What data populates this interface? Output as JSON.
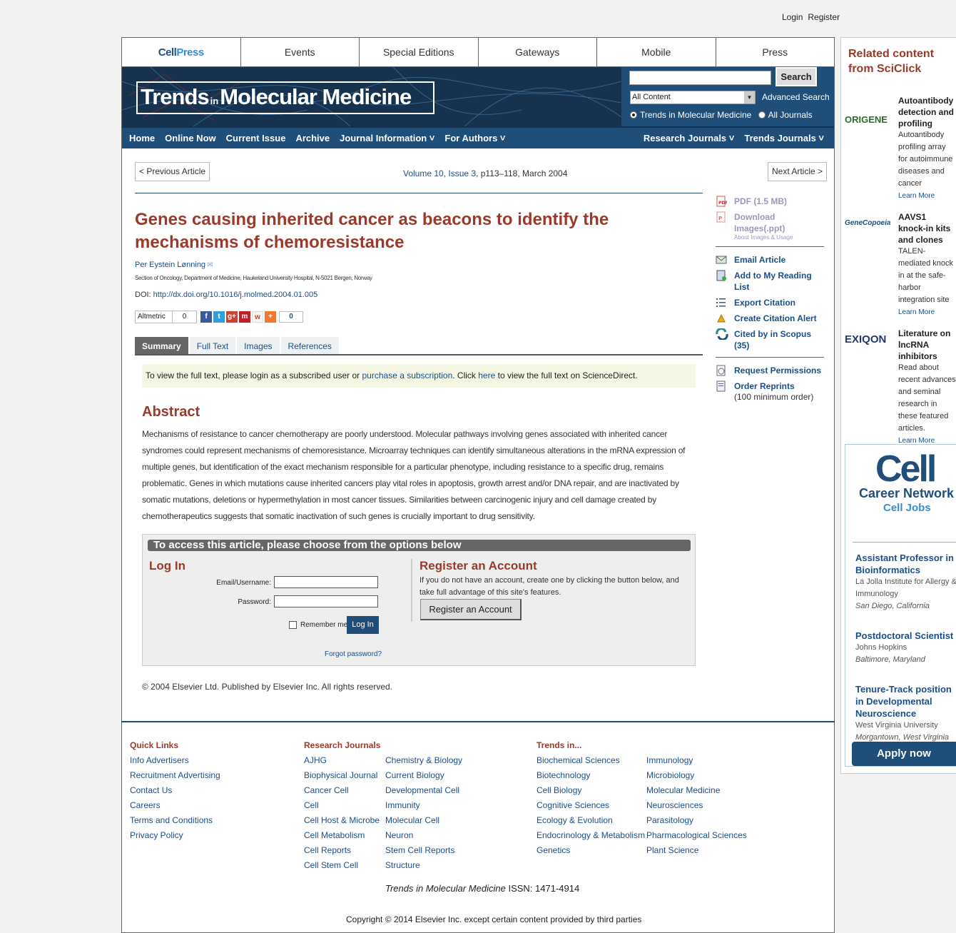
{
  "top_links": {
    "login": "Login",
    "register": "Register"
  },
  "topnav": {
    "cellpress_1": "Cell",
    "cellpress_2": "Press",
    "items": [
      "Events",
      "Special Editions",
      "Gateways",
      "Mobile",
      "Press"
    ]
  },
  "banner": {
    "logo_part1": "Trends",
    "logo_in": "in",
    "logo_part2": "Molecular Medicine",
    "search_button": "Search",
    "content_select": "All Content",
    "advanced_search": "Advanced Search",
    "radio_journal": "Trends in Molecular Medicine",
    "radio_all": "All Journals"
  },
  "mainnav": {
    "home": "Home",
    "online_now": "Online Now",
    "current_issue": "Current Issue",
    "archive": "Archive",
    "journal_info": "Journal Information ˅",
    "for_authors": "For Authors ˅",
    "research_journals": "Research Journals ˅",
    "trends_journals": "Trends Journals ˅"
  },
  "article_nav": {
    "prev": "< Previous Article",
    "next": "Next Article >",
    "volume": "Volume 10, Issue 3",
    "pages": ", p113–118, March 2004"
  },
  "article": {
    "title": "Genes causing inherited cancer as beacons to identify the mechanisms of chemoresistance",
    "author": "Per Eystein Lønning",
    "affiliation": "Section of Oncology, Department of Medicine, Haukeland University Hospital, N-5021 Bergen, Norway",
    "doi_label": "DOI: ",
    "doi_link": "http://dx.doi.org/10.1016/j.molmed.2004.01.005",
    "altmetric": "Altmetric",
    "altmetric_count": "0",
    "share_count": "0"
  },
  "tabs": [
    "Summary",
    "Full Text",
    "Images",
    "References"
  ],
  "notice": {
    "p1": "To view the full text, please login as a subscribed user or ",
    "link1": "purchase a subscription",
    "p2": ". Click ",
    "link2": "here",
    "p3": " to view the full text on ScienceDirect."
  },
  "abstract": {
    "heading": "Abstract",
    "text": "Mechanisms of resistance to cancer chemotherapy are poorly understood. Molecular pathways involving genes associated with inherited cancer syndromes could represent mechanisms of chemoresistance. Microarray techniques can identify simultaneous alterations in the mRNA expression of multiple genes, but identification of the exact mechanism responsible for a particular phenotype, including resistance to a specific drug, remains problematic. Genes in which mutations cause inherited cancers play vital roles in apoptosis, growth arrest and/or DNA repair, and are inactivated by somatic mutations, deletions or hypermethylation in most cancer tissues. Similarities between carcinogenic injury and cell damage created by chemotherapeutics suggests that somatic inactivation of such genes is crucially important to drug sensitivity."
  },
  "access": {
    "heading": "To access this article, please choose from the options below",
    "login_heading": "Log In",
    "email_label": "Email/Username:",
    "password_label": "Password:",
    "remember": "Remember me",
    "login_button": "Log In",
    "forgot": "Forgot password?",
    "register_heading": "Register an Account",
    "register_text": "If you do not have an account, create one by clicking the button below, and take full advantage of this site's features.",
    "register_button": "Register an Account"
  },
  "copyright_article": "© 2004 Elsevier Ltd. Published by Elsevier Inc. All rights reserved.",
  "sidebar": {
    "pdf": "PDF (1.5 MB)",
    "download": "Download Images(.ppt)",
    "about": "About Images & Usage",
    "email": "Email Article",
    "reading_list": "Add to My Reading List",
    "export": "Export Citation",
    "alert": "Create Citation Alert",
    "cited": "Cited by in Scopus (35)",
    "permissions": "Request Permissions",
    "reprints": "Order Reprints",
    "reprints_note": "(100 minimum order)"
  },
  "footer": {
    "quick_links_heading": "Quick Links",
    "quick_links": [
      "Info Advertisers",
      "Recruitment Advertising",
      "Contact Us",
      "Careers",
      "Terms and Conditions",
      "Privacy Policy"
    ],
    "research_heading": "Research Journals",
    "research_col1": [
      "AJHG",
      "Biophysical Journal",
      "Cancer Cell",
      "Cell",
      "Cell Host & Microbe",
      "Cell Metabolism",
      "Cell Reports",
      "Cell Stem Cell"
    ],
    "research_col2": [
      "Chemistry & Biology",
      "Current Biology",
      "Developmental Cell",
      "Immunity",
      "Molecular Cell",
      "Neuron",
      "Stem Cell Reports",
      "Structure"
    ],
    "trends_heading": "Trends in...",
    "trends_col1": [
      "Biochemical Sciences",
      "Biotechnology",
      "Cell Biology",
      "Cognitive Sciences",
      "Ecology & Evolution",
      "Endocrinology & Metabolism",
      "Genetics"
    ],
    "trends_col2": [
      "Immunology",
      "Microbiology",
      "Molecular Medicine",
      "Neurosciences",
      "Parasitology",
      "Pharmacological Sciences",
      "Plant Science"
    ],
    "issn_journal": "Trends in Molecular Medicine",
    "issn": " ISSN: 1471-4914",
    "copyright": "Copyright © 2014 Elsevier Inc. except certain content provided by third parties"
  },
  "related": {
    "heading": "Related content from SciClick",
    "ads": [
      {
        "logo": "ORIGENE",
        "title": "Autoantibody detection and profiling",
        "text": "Autoantibody profiling array for autoimmune diseases and cancer",
        "link": "Learn More"
      },
      {
        "logo": "GeneCopoeia",
        "title": "AAVS1 knock-in kits and clones",
        "text": "TALEN-mediated knock in at the safe-harbor integration site",
        "link": "Learn More"
      },
      {
        "logo": "EXIQON",
        "title": "Literature on lncRNA inhibitors",
        "text": "Read about recent advances and seminal research in these featured articles.",
        "link": "Learn More"
      }
    ]
  },
  "cell_jobs": {
    "logo": "Cell",
    "network": "Career Network",
    "jobs": "Cell Jobs",
    "listings": [
      {
        "title": "Assistant Professor in Bioinformatics",
        "org": "La Jolla Institute for Allergy & Immunology",
        "loc": "San Diego, California"
      },
      {
        "title": "Postdoctoral Scientist",
        "org": "Johns Hopkins",
        "loc": "Baltimore, Maryland"
      },
      {
        "title": "Tenure-Track position in Developmental Neuroscience",
        "org": "West Virginia University",
        "loc": "Morgantown, West Virginia"
      }
    ],
    "apply": "Apply now"
  }
}
